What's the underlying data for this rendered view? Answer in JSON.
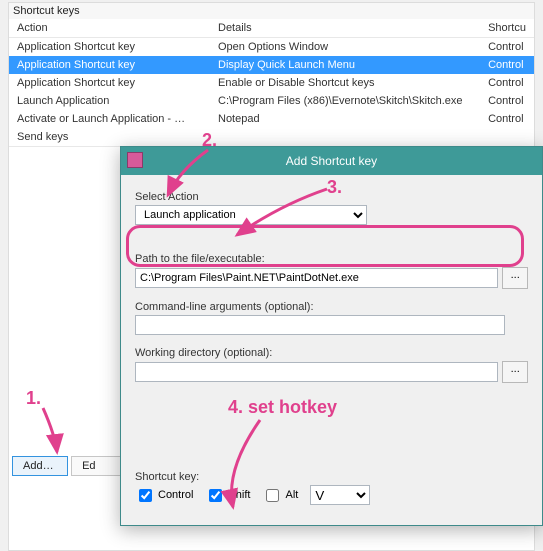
{
  "panel_title": "Shortcut keys",
  "columns": {
    "action": "Action",
    "details": "Details",
    "shortcut": "Shortcu"
  },
  "rows": [
    {
      "action": "Application Shortcut key",
      "details": "Open Options Window",
      "shortcut": "Control",
      "selected": false
    },
    {
      "action": "Application Shortcut key",
      "details": "Display Quick Launch Menu",
      "shortcut": "Control",
      "selected": true
    },
    {
      "action": "Application Shortcut key",
      "details": "Enable or Disable Shortcut keys",
      "shortcut": "Control",
      "selected": false
    },
    {
      "action": "Launch Application",
      "details": "C:\\Program Files (x86)\\Evernote\\Skitch\\Skitch.exe",
      "shortcut": "Control",
      "selected": false
    },
    {
      "action": "Activate or Launch Application - …",
      "details": "Notepad",
      "shortcut": "Control",
      "selected": false
    },
    {
      "action": "Send keys",
      "details": "",
      "shortcut": "",
      "selected": false
    }
  ],
  "buttons": {
    "add": "Add…",
    "edit": "Ed"
  },
  "dialog": {
    "title": "Add Shortcut key",
    "select_action_label": "Select Action",
    "select_action_value": "Launch application",
    "path_label": "Path to the file/executable:",
    "path_value": "C:\\Program Files\\Paint.NET\\PaintDotNet.exe",
    "cmdline_label": "Command-line arguments (optional):",
    "cmdline_value": "",
    "workdir_label": "Working directory (optional):",
    "workdir_value": "",
    "browse": "...",
    "shortcut_label": "Shortcut key:",
    "control_label": "Control",
    "shift_label": "Shift",
    "alt_label": "Alt",
    "control_checked": true,
    "shift_checked": true,
    "alt_checked": false,
    "key_value": "V"
  },
  "annotations": {
    "n1": "1.",
    "n2": "2.",
    "n3": "3.",
    "n4": "4. set hotkey"
  }
}
